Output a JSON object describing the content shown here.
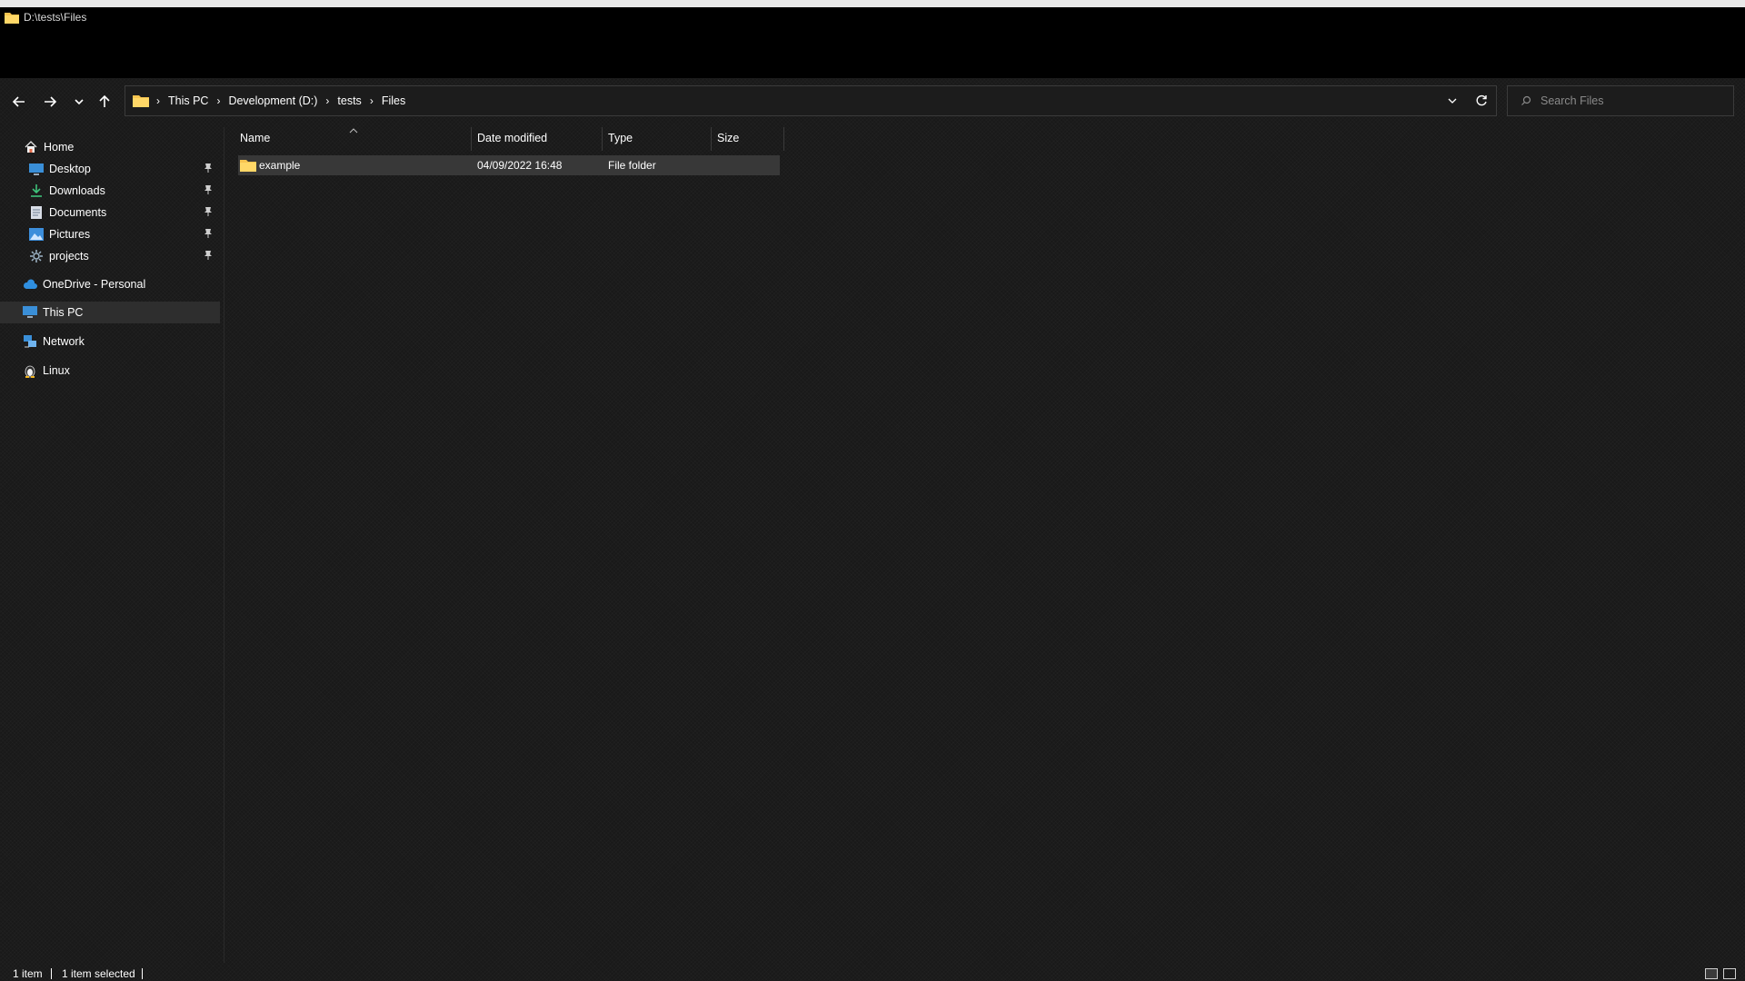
{
  "window": {
    "title": "D:\\tests\\Files"
  },
  "address": {
    "crumbs": [
      "This PC",
      "Development (D:)",
      "tests",
      "Files"
    ]
  },
  "search": {
    "placeholder": "Search Files"
  },
  "sidebar": {
    "home": "Home",
    "pinned": [
      {
        "label": "Desktop",
        "icon": "desktop-icon"
      },
      {
        "label": "Downloads",
        "icon": "download-icon"
      },
      {
        "label": "Documents",
        "icon": "document-icon"
      },
      {
        "label": "Pictures",
        "icon": "pictures-icon"
      },
      {
        "label": "projects",
        "icon": "projects-icon"
      }
    ],
    "onedrive": "OneDrive - Personal",
    "thispc": "This PC",
    "network": "Network",
    "linux": "Linux"
  },
  "columns": {
    "name": "Name",
    "date": "Date modified",
    "type": "Type",
    "size": "Size"
  },
  "files": [
    {
      "name": "example",
      "date": "04/09/2022 16:48",
      "type": "File folder",
      "size": ""
    }
  ],
  "status": {
    "count": "1 item",
    "selected": "1 item selected"
  },
  "colors": {
    "folder": "#f8c44f",
    "selected_row": "#383838",
    "nav_selected": "#2e2e2e"
  }
}
